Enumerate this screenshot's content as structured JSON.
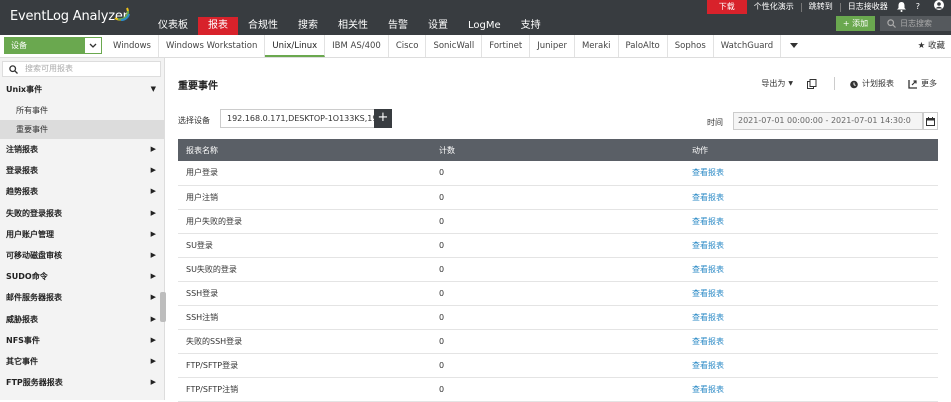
{
  "app": {
    "title": "EventLog Analyzer"
  },
  "nav": [
    "仪表板",
    "报表",
    "合规性",
    "搜索",
    "相关性",
    "告警",
    "设置",
    "LogMe",
    "支持"
  ],
  "nav_active": 1,
  "util": {
    "download": "下载",
    "personalize": "个性化演示",
    "jump": "跳转到",
    "log_receiver": "日志接收器",
    "help": "?",
    "add": "+ 添加",
    "search_placeholder": "日志搜索"
  },
  "device_select": "设备",
  "device_tabs": [
    "Windows",
    "Windows Workstation",
    "Unix/Linux",
    "IBM AS/400",
    "Cisco",
    "SonicWall",
    "Fortinet",
    "Juniper",
    "Meraki",
    "PaloAlto",
    "Sophos",
    "WatchGuard"
  ],
  "device_tab_active": 2,
  "favorites": "收藏",
  "sidebar": {
    "search_placeholder": "搜索可用报表",
    "group_open": "Unix事件",
    "sub_items": [
      "所有事件",
      "重要事件"
    ],
    "sub_active": 1,
    "items": [
      "注销报表",
      "登录报表",
      "趋势报表",
      "失败的登录报表",
      "用户账户管理",
      "可移动磁盘审核",
      "SUDO命令",
      "邮件服务器报表",
      "威胁报表",
      "NFS事件",
      "其它事件",
      "FTP服务器报表"
    ]
  },
  "main": {
    "title": "重要事件",
    "tools": {
      "export": "导出为",
      "schedule": "计划报表",
      "more": "更多"
    },
    "select_device_label": "选择设备",
    "select_device_value": "192.168.0.171,DESKTOP-1O133KS,192",
    "time_label": "时间",
    "time_value": "2021-07-01 00:00:00 - 2021-07-01 14:30:0",
    "columns": [
      "报表名称",
      "计数",
      "动作"
    ],
    "rows": [
      {
        "name": "用户登录",
        "count": "0",
        "action": "查看报表"
      },
      {
        "name": "用户注销",
        "count": "0",
        "action": "查看报表"
      },
      {
        "name": "用户失败的登录",
        "count": "0",
        "action": "查看报表"
      },
      {
        "name": "SU登录",
        "count": "0",
        "action": "查看报表"
      },
      {
        "name": "SU失败的登录",
        "count": "0",
        "action": "查看报表"
      },
      {
        "name": "SSH登录",
        "count": "0",
        "action": "查看报表"
      },
      {
        "name": "SSH注销",
        "count": "0",
        "action": "查看报表"
      },
      {
        "name": "失败的SSH登录",
        "count": "0",
        "action": "查看报表"
      },
      {
        "name": "FTP/SFTP登录",
        "count": "0",
        "action": "查看报表"
      },
      {
        "name": "FTP/SFTP注销",
        "count": "0",
        "action": "查看报表"
      }
    ]
  },
  "colors": {
    "topbar": "#383c40",
    "accent_red": "#d8222b",
    "accent_green": "#6aa84f",
    "link": "#2b8ac6"
  }
}
